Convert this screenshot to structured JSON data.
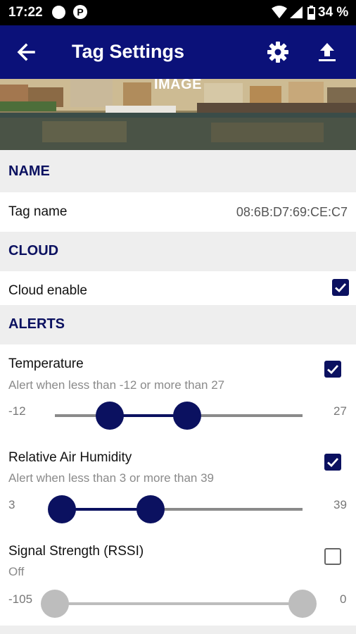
{
  "status_bar": {
    "time": "17:22",
    "notif_p": "P",
    "battery": "34 %"
  },
  "app_bar": {
    "title": "Tag Settings"
  },
  "banner": {
    "label": "IMAGE"
  },
  "sections": {
    "name": {
      "header": "NAME",
      "tag_name_label": "Tag name",
      "tag_name_value": "08:6B:D7:69:CE:C7"
    },
    "cloud": {
      "header": "CLOUD",
      "enable_label": "Cloud enable",
      "enabled": true
    },
    "alerts": {
      "header": "ALERTS",
      "items": [
        {
          "title": "Temperature",
          "subtitle": "Alert when less than -12 or more than 27",
          "min_label": "-12",
          "max_label": "27",
          "checked": true
        },
        {
          "title": "Relative Air Humidity",
          "subtitle": "Alert when less than 3 or more than 39",
          "min_label": "3",
          "max_label": "39",
          "checked": true
        },
        {
          "title": "Signal Strength (RSSI)",
          "subtitle": "Off",
          "min_label": "-105",
          "max_label": "0",
          "checked": false
        }
      ]
    }
  },
  "colors": {
    "primary": "#0b1179",
    "section_text": "#0b1160",
    "header_bg": "#eeeeee"
  },
  "icons": [
    "back-arrow-icon",
    "gear-icon",
    "upload-icon",
    "wifi-icon",
    "signal-icon",
    "battery-icon",
    "checkmark-icon"
  ]
}
